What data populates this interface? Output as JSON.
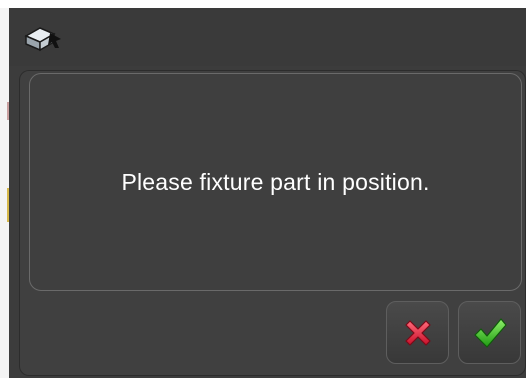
{
  "dialog": {
    "message": "Please fixture part in position.",
    "icon": "fixture-part-icon"
  },
  "buttons": {
    "cancel": {
      "icon": "cancel-x-icon",
      "color": "#e8203a"
    },
    "confirm": {
      "icon": "confirm-check-icon",
      "color": "#3cc51f"
    }
  },
  "colors": {
    "window_bg": "#3c3c3c",
    "panel_border": "#6a6a6a",
    "text": "#ffffff"
  }
}
